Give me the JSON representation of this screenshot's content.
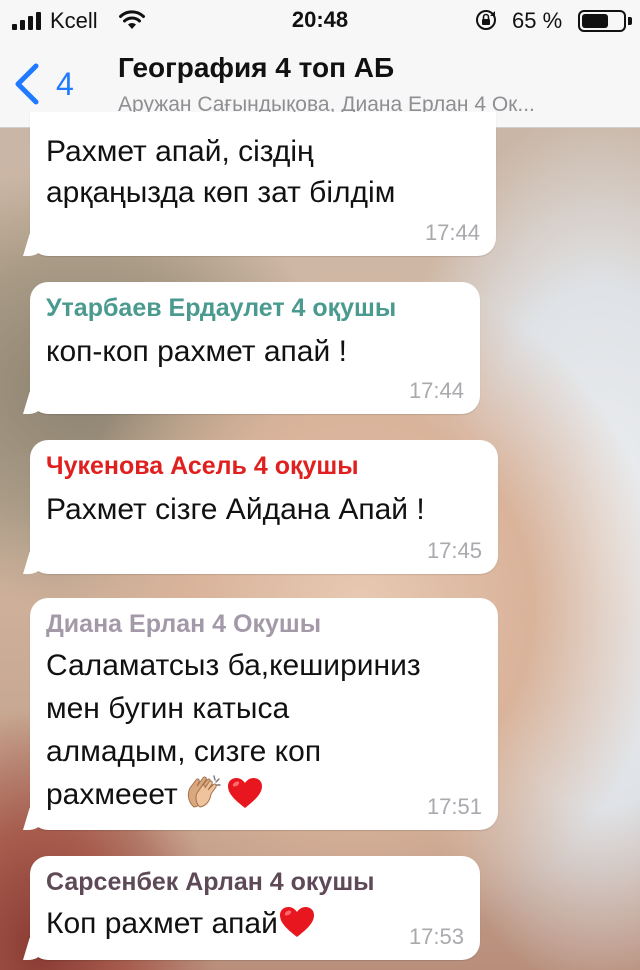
{
  "status_bar": {
    "carrier": "Kcell",
    "time": "20:48",
    "battery": "65 %",
    "battery_level": 0.65
  },
  "header": {
    "back_count": "4",
    "title": "География 4 топ АБ",
    "subtitle": "Аружан Сағындықова, Диана Ерлан 4 Ок..."
  },
  "colors": {
    "accent": "#1f7aff",
    "sender_teal": "#4a9a8f",
    "sender_red": "#e0201e",
    "sender_gray": "#a499a8",
    "sender_dark": "#5e4a56"
  },
  "messages": [
    {
      "sender": "",
      "lines": [
        "Рахмет апай, сіздің",
        "арқаңызда көп зат білдім"
      ],
      "time": "17:44"
    },
    {
      "sender": "Утарбаев Ердаулет 4 оқушы",
      "lines": [
        "коп-коп рахмет апай !"
      ],
      "time": "17:44"
    },
    {
      "sender": "Чукенова Асель 4 оқушы",
      "lines": [
        "Рахмет сізге Айдана Апай !"
      ],
      "time": "17:45"
    },
    {
      "sender": "Диана Ерлан 4 Окушы",
      "lines": [
        "Саламатсыз ба,кешириниз",
        "мен бугин катыса",
        "алмадым, сизге коп",
        "рахмееет"
      ],
      "emojis": [
        "clapping-hands",
        "red-heart"
      ],
      "time": "17:51"
    },
    {
      "sender": "Сарсенбек Арлан 4 окушы",
      "lines": [
        "Коп рахмет апай"
      ],
      "emojis": [
        "red-heart"
      ],
      "time": "17:53"
    }
  ]
}
